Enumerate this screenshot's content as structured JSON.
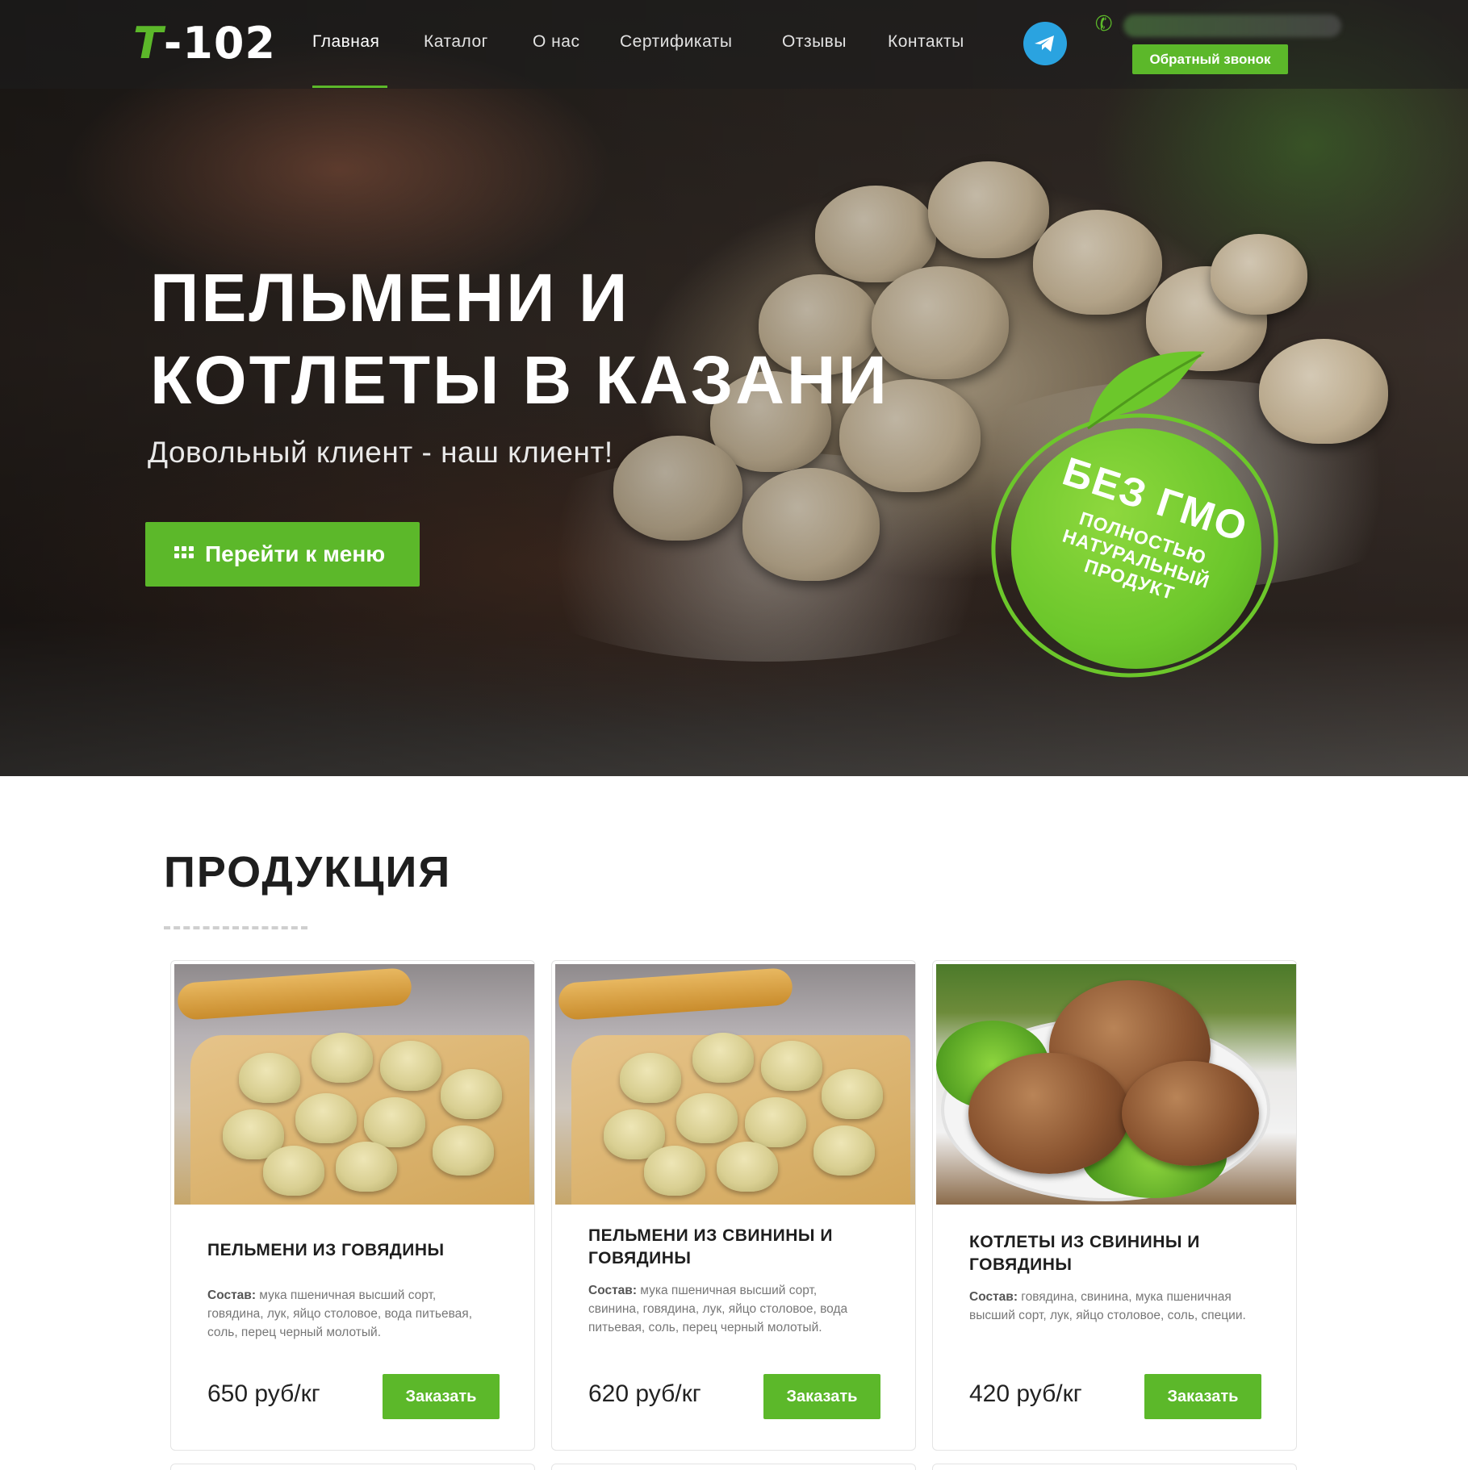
{
  "header": {
    "logo": {
      "accent": "Т",
      "rest": "-102"
    },
    "nav": [
      {
        "label": "Главная",
        "active": true
      },
      {
        "label": "Каталог"
      },
      {
        "label": "О нас"
      },
      {
        "label": "Сертификаты"
      },
      {
        "label": "Отзывы"
      },
      {
        "label": "Контакты"
      }
    ],
    "telegram_icon": "telegram-icon",
    "phone_icon": "phone-icon",
    "callback_label": "Обратный звонок"
  },
  "hero": {
    "title_line1": "ПЕЛЬМЕНИ И",
    "title_line2": "КОТЛЕТЫ В КАЗАНИ",
    "subtitle": "Довольный клиент - наш клиент!",
    "cta_label": "Перейти к меню",
    "badge": {
      "big": "БЕЗ ГМО",
      "line1": "ПОЛНОСТЬЮ",
      "line2": "НАТУРАЛЬНЫЙ",
      "line3": "ПРОДУКТ"
    }
  },
  "products": {
    "title": "ПРОДУКЦИЯ",
    "items": [
      {
        "title": "ПЕЛЬМЕНИ ИЗ ГОВЯДИНЫ",
        "comp_label": "Состав:",
        "comp": " мука пшеничная высший сорт, говядина, лук, яйцо столовое, вода питьевая, соль, перец черный молотый.",
        "price": "650 руб/кг",
        "button": "Заказать"
      },
      {
        "title": "ПЕЛЬМЕНИ ИЗ СВИНИНЫ И ГОВЯДИНЫ",
        "comp_label": "Состав:",
        "comp": " мука пшеничная высший сорт, свинина, говядина, лук, яйцо столовое, вода питьевая, соль, перец черный молотый.",
        "price": "620 руб/кг",
        "button": "Заказать"
      },
      {
        "title": "КОТЛЕТЫ ИЗ СВИНИНЫ И ГОВЯДИНЫ",
        "comp_label": "Состав:",
        "comp": " говядина, свинина, мука пшеничная высший сорт, лук, яйцо столовое, соль, специи.",
        "price": "420 руб/кг",
        "button": "Заказать"
      }
    ]
  },
  "colors": {
    "accent": "#5cb82a",
    "telegram": "#2aa3e0",
    "text_dark": "#1e1e1e"
  }
}
